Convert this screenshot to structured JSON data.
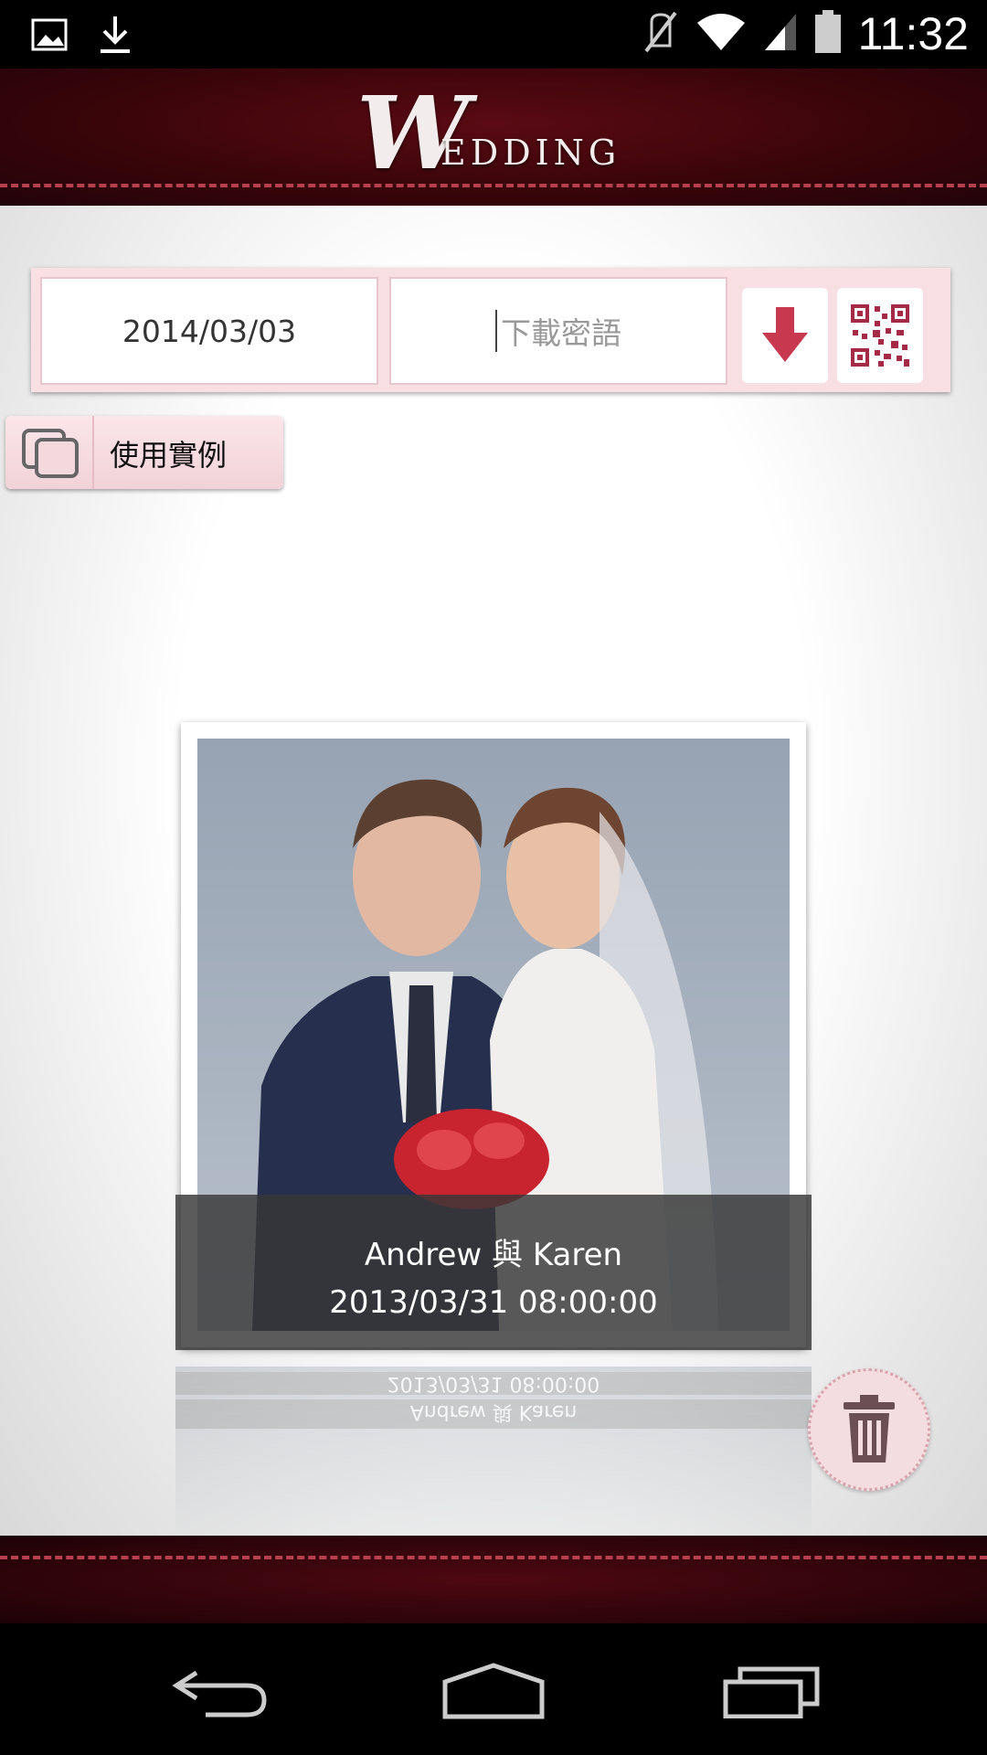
{
  "status_bar": {
    "time": "11:32",
    "icons": [
      "image-icon",
      "download-icon",
      "mute-icon",
      "wifi-icon",
      "signal-icon",
      "battery-icon"
    ]
  },
  "header": {
    "logo_initial": "W",
    "logo_rest": "EDDING"
  },
  "toolbar": {
    "date_value": "2014/03/03",
    "password_placeholder": "下載密語",
    "download_button": "download-arrow-icon",
    "qr_button": "qr-code-icon"
  },
  "example_button": {
    "label": "使用實例"
  },
  "album": {
    "names": "Andrew 與 Karen",
    "datetime": "2013/03/31 08:00:00"
  },
  "colors": {
    "header_bg": "#3a0509",
    "accent_pink": "#f8dfe4",
    "download_red": "#c8384f"
  },
  "nav": {
    "buttons": [
      "back-icon",
      "home-icon",
      "recents-icon"
    ]
  }
}
